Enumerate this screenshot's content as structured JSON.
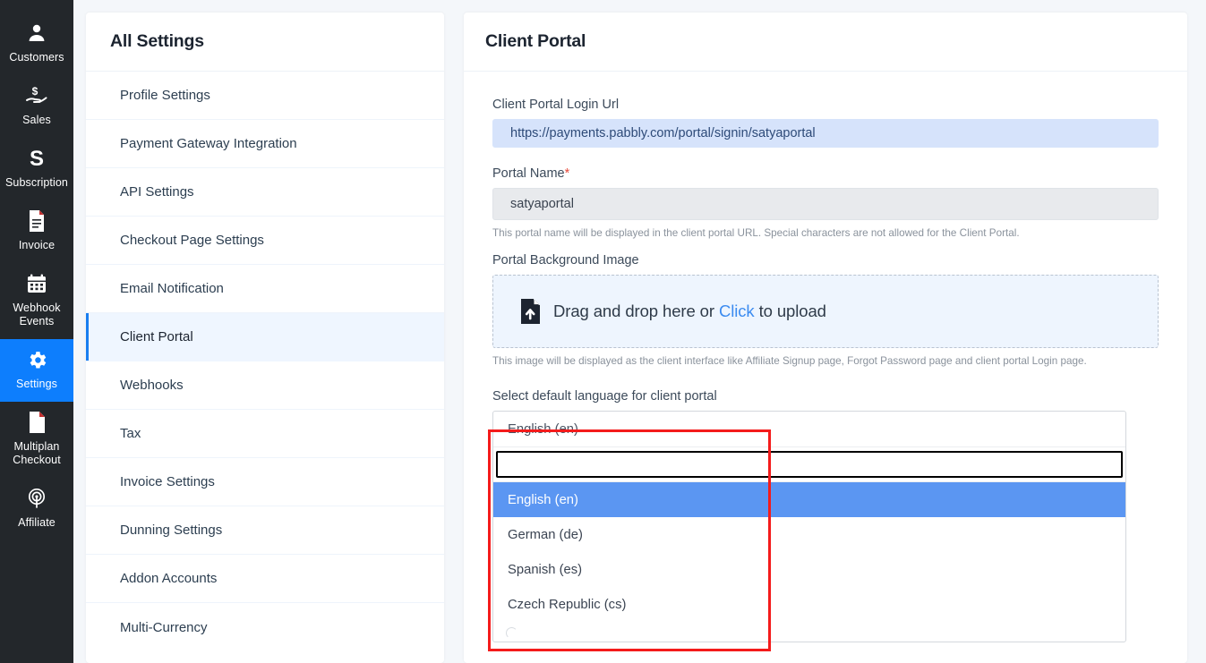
{
  "sidebar": {
    "items": [
      {
        "label": "Customers",
        "icon": "user-icon",
        "active": false
      },
      {
        "label": "Sales",
        "icon": "hand-dollar-icon",
        "active": false
      },
      {
        "label": "Subscription",
        "icon": "letter-s-icon",
        "active": false
      },
      {
        "label": "Invoice",
        "icon": "document-lines-icon",
        "active": false
      },
      {
        "label": "Webhook Events",
        "icon": "calendar-icon",
        "active": false
      },
      {
        "label": "Settings",
        "icon": "gear-icon",
        "active": true
      },
      {
        "label": "Multiplan Checkout",
        "icon": "page-icon",
        "active": false
      },
      {
        "label": "Affiliate",
        "icon": "broadcast-icon",
        "active": false
      }
    ],
    "active_color": "#0d7efd",
    "background": "#23272b"
  },
  "settings_panel": {
    "title": "All Settings",
    "items": [
      {
        "label": "Profile Settings",
        "active": false
      },
      {
        "label": "Payment Gateway Integration",
        "active": false
      },
      {
        "label": "API Settings",
        "active": false
      },
      {
        "label": "Checkout Page Settings",
        "active": false
      },
      {
        "label": "Email Notification",
        "active": false
      },
      {
        "label": "Client Portal",
        "active": true
      },
      {
        "label": "Webhooks",
        "active": false
      },
      {
        "label": "Tax",
        "active": false
      },
      {
        "label": "Invoice Settings",
        "active": false
      },
      {
        "label": "Dunning Settings",
        "active": false
      },
      {
        "label": "Addon Accounts",
        "active": false
      },
      {
        "label": "Multi-Currency",
        "active": false
      }
    ],
    "active_accent": "#1a7ef0",
    "active_background": "#eff6ff"
  },
  "detail": {
    "title": "Client Portal",
    "login_url": {
      "label": "Client Portal Login Url",
      "value": "https://payments.pabbly.com/portal/signin/satyaportal",
      "background": "#d6e3fb"
    },
    "portal_name": {
      "label": "Portal Name",
      "required_marker": "*",
      "value": "satyaportal",
      "placeholder": "Portal Name",
      "help": "This portal name will be displayed in the client portal URL. Special characters are not allowed for the Client Portal."
    },
    "background_image": {
      "label": "Portal Background Image",
      "dropzone_prefix": "Drag and drop here or ",
      "dropzone_link": "Click",
      "dropzone_suffix": " to upload",
      "icon": "file-upload-icon",
      "help": "This image will be displayed as the client interface like Affiliate Signup page, Forgot Password page and client portal Login page."
    },
    "language": {
      "label": "Select default language for client portal",
      "selected": "English (en)",
      "search_value": "",
      "search_placeholder": "",
      "options": [
        {
          "label": "English (en)",
          "selected": true
        },
        {
          "label": "German (de)",
          "selected": false
        },
        {
          "label": "Spanish (es)",
          "selected": false
        },
        {
          "label": "Czech Republic (cs)",
          "selected": false
        }
      ],
      "highlight_color": "#5b96f2"
    }
  },
  "annotation": {
    "color": "#f41b1b",
    "target": "language-dropdown"
  }
}
